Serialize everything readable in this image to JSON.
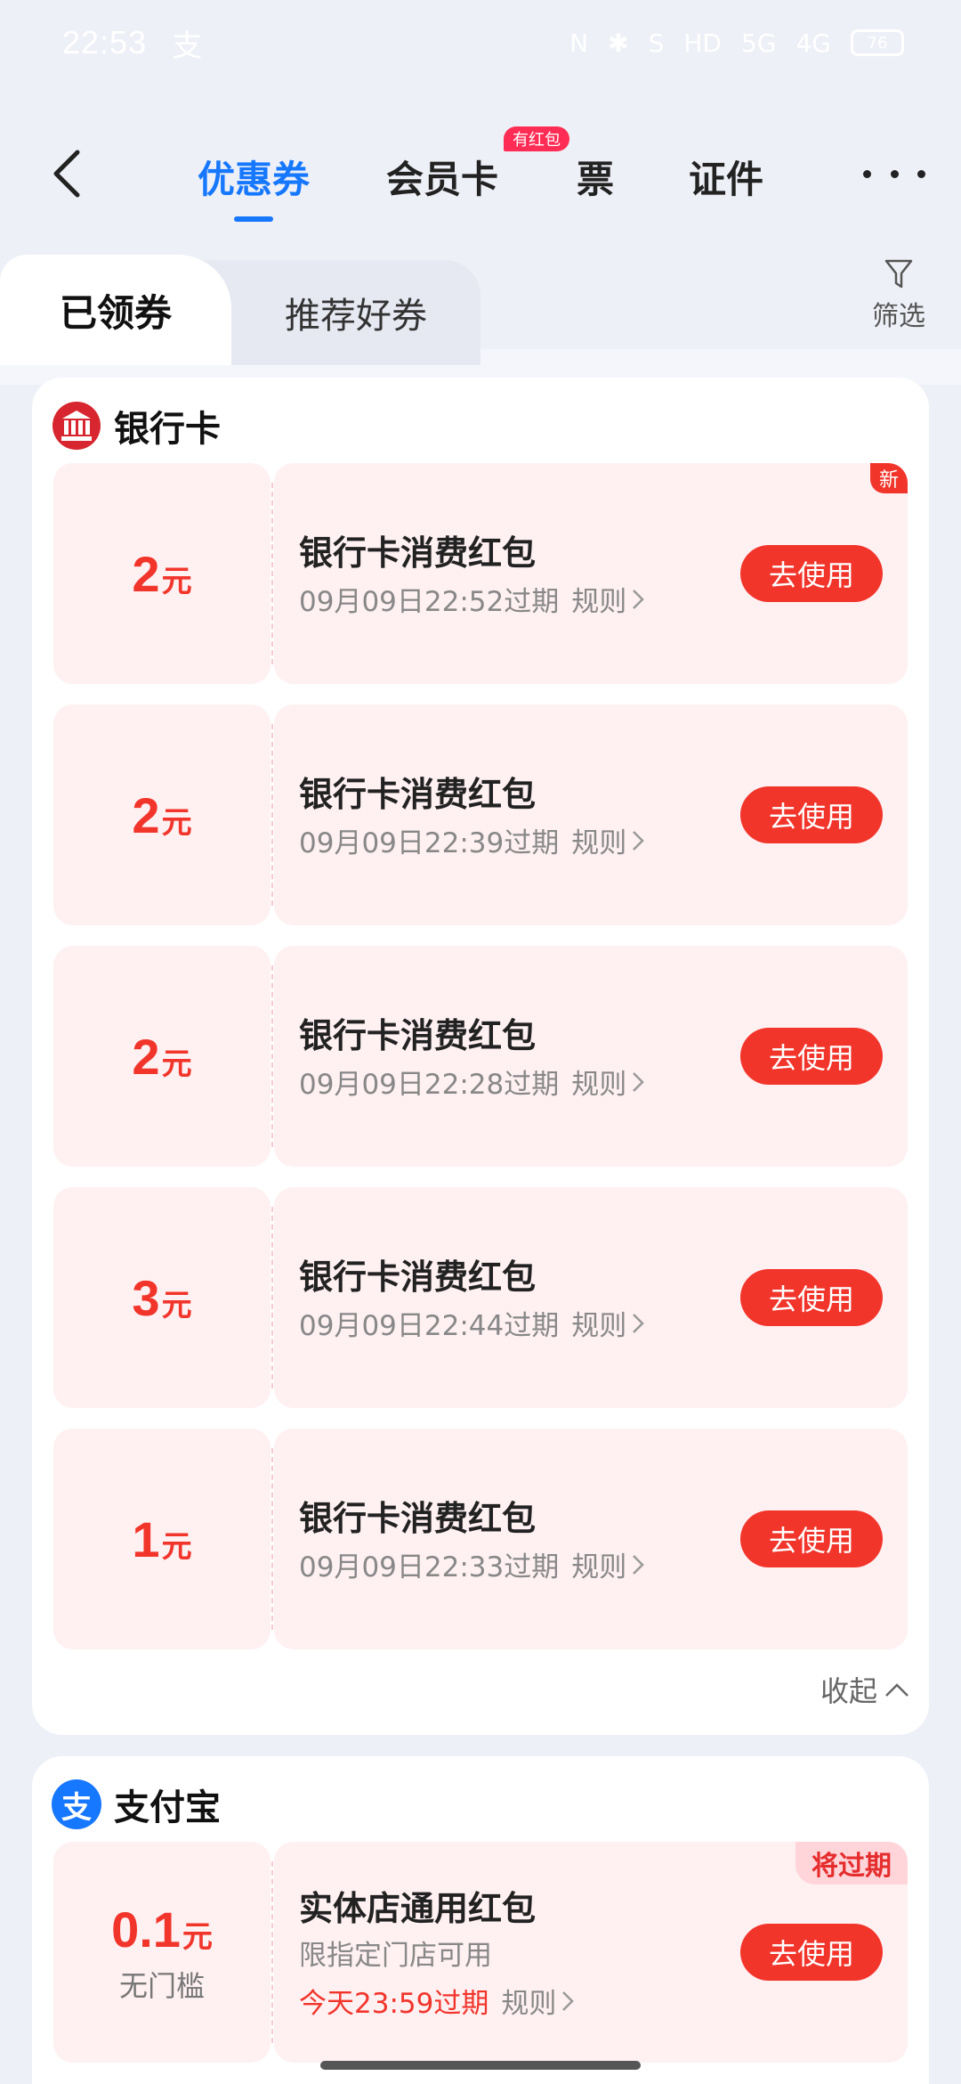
{
  "status_bar": {
    "time": "22:53",
    "alipay_glyph": "支",
    "nfc": "N",
    "bluetooth": "✱",
    "shield": "S",
    "hd": "HD",
    "signal_1": "5G",
    "signal_2": "4G",
    "battery": "76"
  },
  "header": {
    "tabs": [
      {
        "label": "优惠券",
        "active": true
      },
      {
        "label": "会员卡"
      },
      {
        "label": "票"
      },
      {
        "label": "证件"
      }
    ],
    "badge": "有红包"
  },
  "subtabs": {
    "active": "已领券",
    "inactive": "推荐好券",
    "filter_label": "筛选"
  },
  "bank_section": {
    "title": "银行卡",
    "coupons": [
      {
        "amount": "2",
        "unit": "元",
        "title": "银行卡消费红包",
        "expire": "09月09日22:52过期",
        "rule": "规则",
        "button": "去使用",
        "badge": "新"
      },
      {
        "amount": "2",
        "unit": "元",
        "title": "银行卡消费红包",
        "expire": "09月09日22:39过期",
        "rule": "规则",
        "button": "去使用"
      },
      {
        "amount": "2",
        "unit": "元",
        "title": "银行卡消费红包",
        "expire": "09月09日22:28过期",
        "rule": "规则",
        "button": "去使用"
      },
      {
        "amount": "3",
        "unit": "元",
        "title": "银行卡消费红包",
        "expire": "09月09日22:44过期",
        "rule": "规则",
        "button": "去使用"
      },
      {
        "amount": "1",
        "unit": "元",
        "title": "银行卡消费红包",
        "expire": "09月09日22:33过期",
        "rule": "规则",
        "button": "去使用"
      }
    ],
    "collapse_label": "收起"
  },
  "alipay_section": {
    "title": "支付宝",
    "logo_glyph": "支",
    "coupon": {
      "amount": "0.1",
      "unit": "元",
      "threshold": "无门槛",
      "title": "实体店通用红包",
      "desc": "限指定门店可用",
      "expire": "今天23:59过期",
      "rule": "规则",
      "button": "去使用",
      "badge": "将过期"
    }
  },
  "colors": {
    "accent_blue": "#1677ff",
    "coupon_red": "#f2352b",
    "coupon_bg": "#fff0f2"
  }
}
